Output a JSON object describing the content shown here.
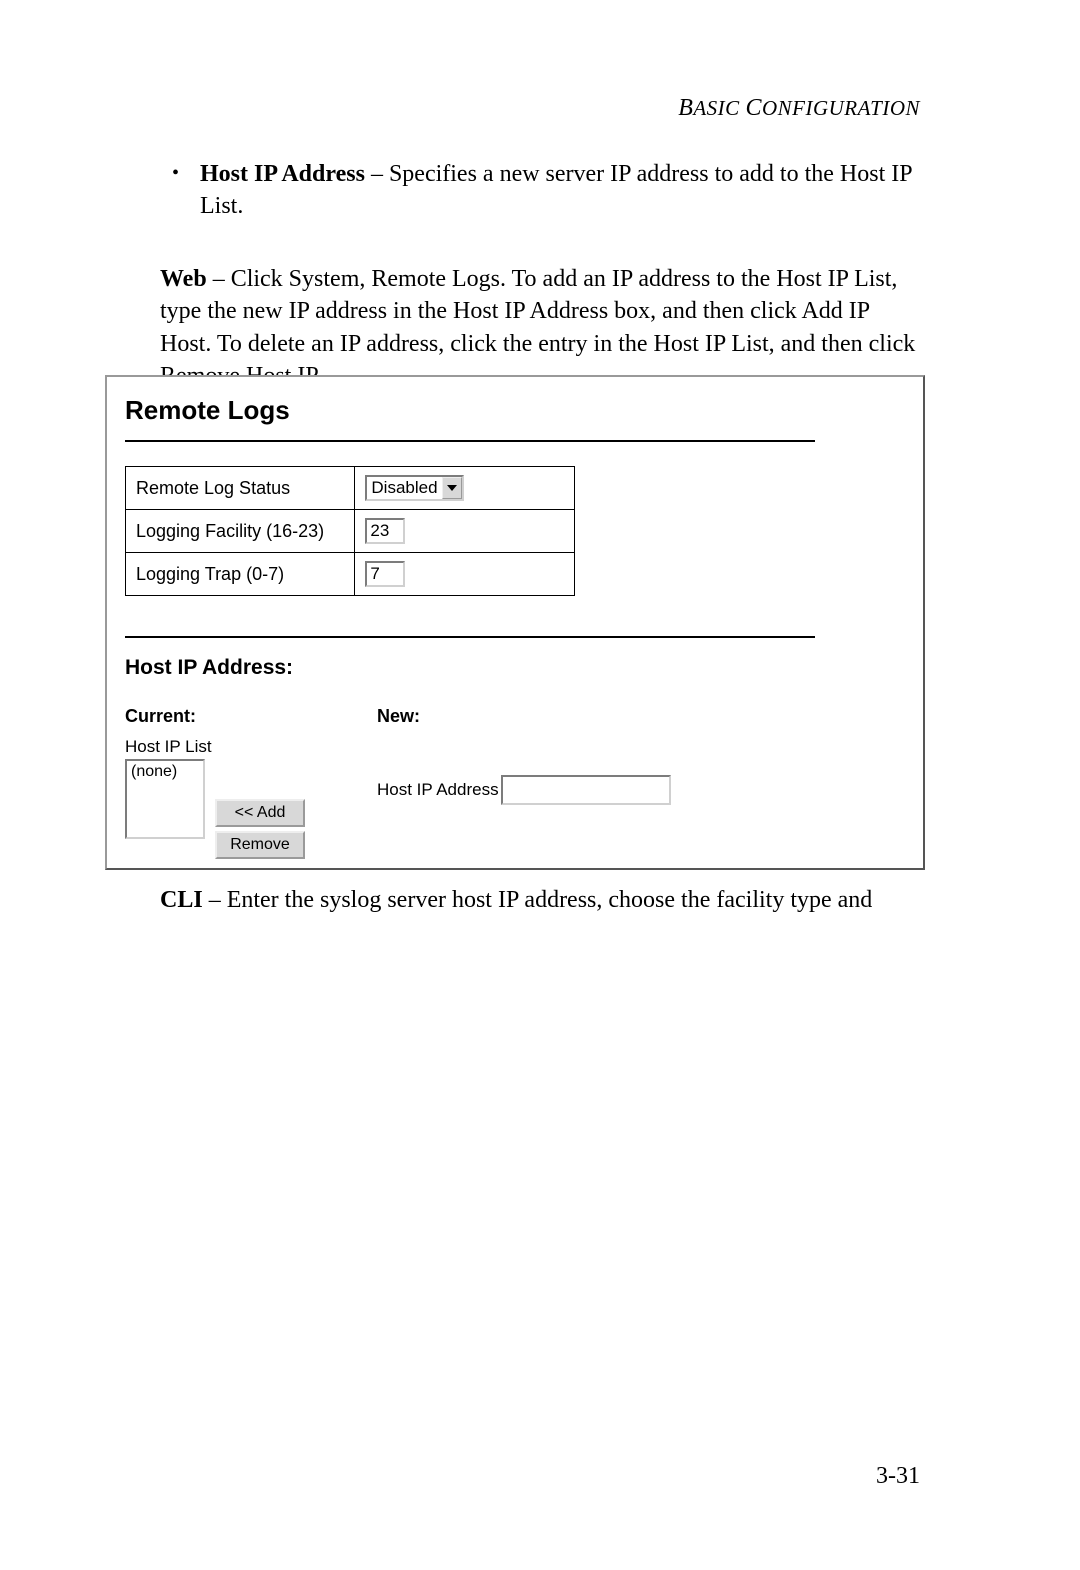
{
  "header": {
    "title": "Basic Configuration"
  },
  "bullet": {
    "term": "Host IP Address",
    "desc": " – Specifies a new server IP address to add to the Host IP List."
  },
  "web_para": {
    "prefix": "Web",
    "text": " – Click System, Remote Logs. To add an IP address to the Host IP List, type the new IP address in the Host IP Address box, and then click Add IP Host. To delete an IP address, click the entry in the Host IP List, and then click Remove Host IP."
  },
  "panel": {
    "title": "Remote Logs",
    "rows": [
      {
        "label": "Remote Log Status",
        "value": "Disabled",
        "type": "dropdown"
      },
      {
        "label": "Logging Facility (16-23)",
        "value": "23",
        "type": "text"
      },
      {
        "label": "Logging Trap (0-7)",
        "value": "7",
        "type": "text"
      }
    ],
    "host_section": {
      "title": "Host IP Address:",
      "current_label": "Current:",
      "new_label": "New:",
      "list_label": "Host IP List",
      "list_value": "(none)",
      "add_button": "<< Add",
      "remove_button": "Remove",
      "new_field_label": "Host IP Address",
      "new_field_value": ""
    }
  },
  "cli_para": {
    "prefix": "CLI",
    "text": " – Enter the syslog server host IP address, choose the facility type and"
  },
  "page_number": "3-31"
}
